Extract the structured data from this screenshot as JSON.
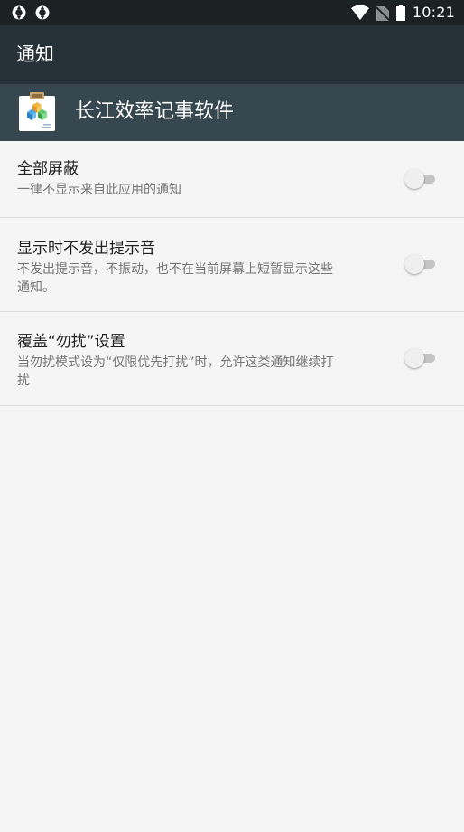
{
  "status_bar": {
    "left_icons": [
      "sync-icon",
      "sync-icon"
    ],
    "right_icons": [
      "wifi-icon",
      "no-sim-icon",
      "battery-icon"
    ],
    "time": "10:21"
  },
  "app_bar": {
    "title": "通知"
  },
  "app_header": {
    "icon": "clipboard-app-icon",
    "app_name": "长江效率记事软件"
  },
  "settings": [
    {
      "label": "全部屏蔽",
      "description": "一律不显示来自此应用的通知",
      "enabled": false
    },
    {
      "label": "显示时不发出提示音",
      "description_lines": [
        "不发出提示音，不振动，也不在当前屏幕上短暂显示这些",
        "通知。"
      ],
      "enabled": false
    },
    {
      "label": "覆盖“勿扰”设置",
      "description_lines": [
        "当勿扰模式设为“仅限优先打扰”时，允许这类通知继续打",
        "扰"
      ],
      "enabled": false
    }
  ]
}
